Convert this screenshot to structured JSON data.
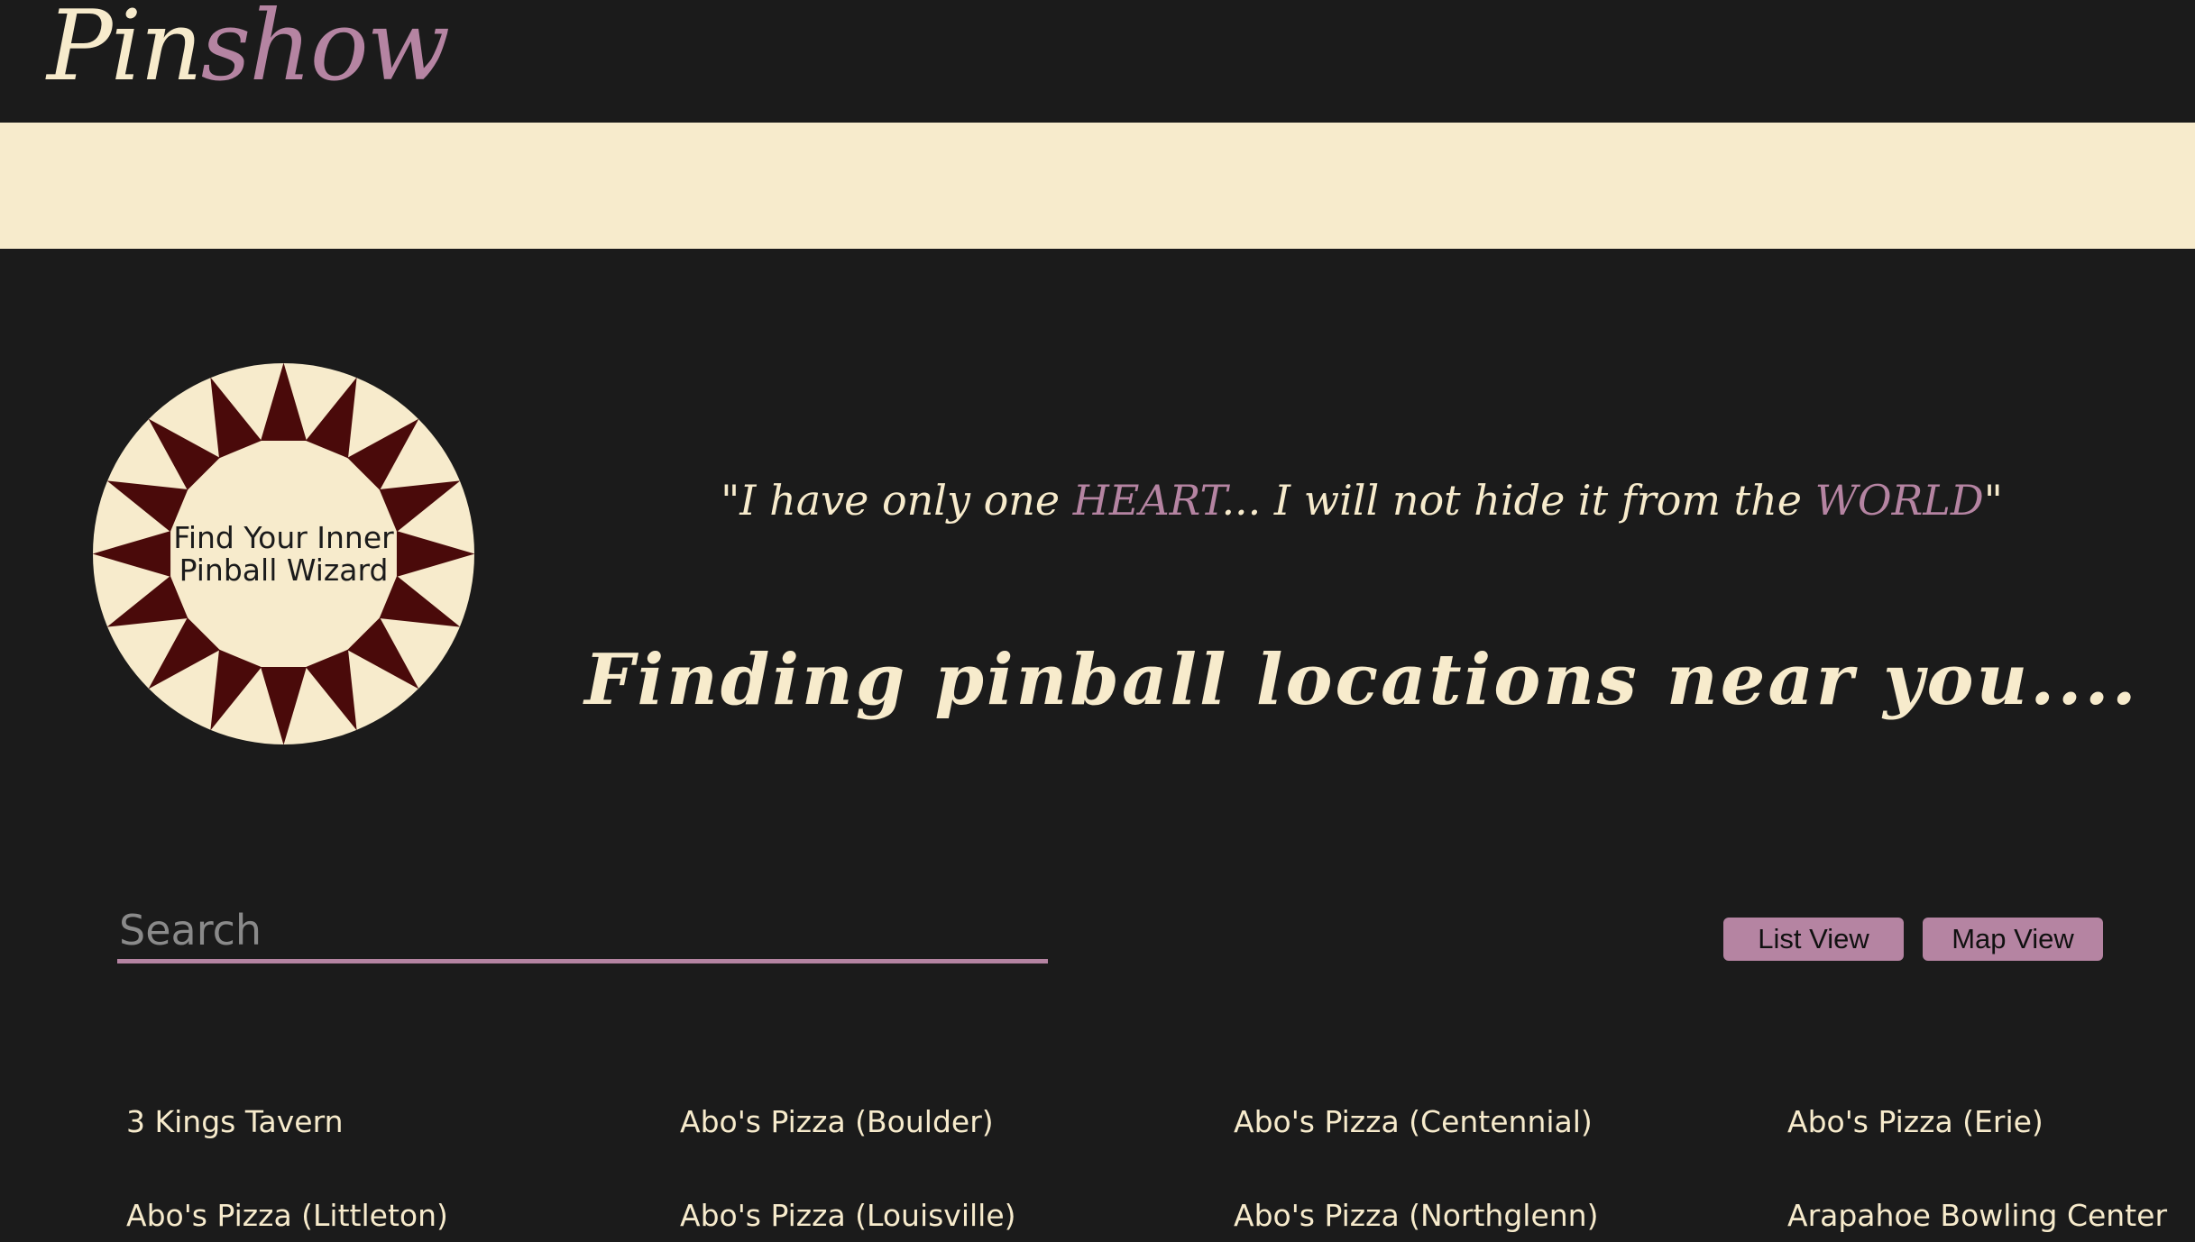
{
  "header": {
    "logo_part1": "Pin",
    "logo_part2": "show"
  },
  "badge": {
    "text": "Find Your Inner Pinball Wizard"
  },
  "quote": {
    "open_quote": "\"",
    "part1": "I have only one ",
    "accent1": "HEART",
    "part2": "... I will not hide it from the ",
    "accent2": "WORLD",
    "close_quote": "\""
  },
  "tagline": "Finding pinball locations near you....",
  "search": {
    "placeholder": "Search",
    "value": ""
  },
  "view_buttons": {
    "list_label": "List View",
    "map_label": "Map View"
  },
  "locations": [
    "3 Kings Tavern",
    "Abo's Pizza (Boulder)",
    "Abo's Pizza (Centennial)",
    "Abo's Pizza (Erie)",
    "Abo's Pizza (Littleton)",
    "Abo's Pizza (Louisville)",
    "Abo's Pizza (Northglenn)",
    "Arapahoe Bowling Center"
  ],
  "colors": {
    "background": "#1b1b1b",
    "cream": "#f7ebcc",
    "accent": "#b584a2",
    "star": "#4a0a0a"
  }
}
